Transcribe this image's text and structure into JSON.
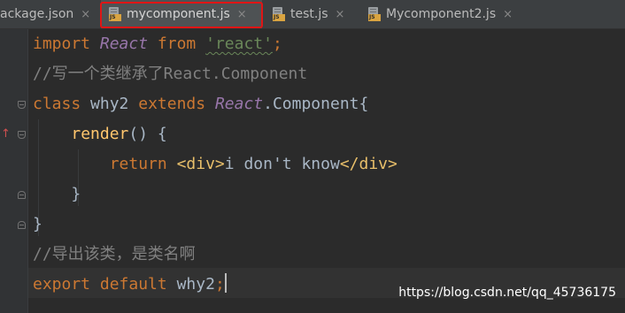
{
  "tabs": [
    {
      "label": "ackage.json",
      "icon": "json-file-icon",
      "active": false,
      "highlighted": false
    },
    {
      "label": "mycomponent.js",
      "icon": "js-file-icon",
      "active": true,
      "highlighted": true
    },
    {
      "label": "test.js",
      "icon": "js-file-icon",
      "active": false,
      "highlighted": false
    },
    {
      "label": "Mycomponent2.js",
      "icon": "js-file-icon",
      "active": false,
      "highlighted": false
    }
  ],
  "icons": {
    "close": "×",
    "file_badge": "JS",
    "override_marker": "↑"
  },
  "code_lines": [
    {
      "t1": "import",
      "t2": "React",
      "t3": "from",
      "t4": "'react'",
      "t5": ";"
    },
    {
      "text": "//写一个类继承了React.Component"
    },
    {
      "t1": "class",
      "t2": "why2",
      "t3": "extends",
      "t4": "React",
      "t5": ".Component{"
    },
    {
      "t1": "render",
      "t2": "() {"
    },
    {
      "t1": "return",
      "t2": "<div>",
      "t3": "i don't know",
      "t4": "</div>"
    },
    {
      "text": "}"
    },
    {
      "text": "}"
    },
    {
      "text": "//导出该类，是类名啊"
    },
    {
      "t1": "export",
      "t2": "default",
      "t3": "why2",
      "t4": ";"
    }
  ],
  "watermark": "https://blog.csdn.net/qq_45736175",
  "colors": {
    "editor_background": "#2b2b2b",
    "keyword": "#cc7832",
    "class_reference": "#9876aa",
    "function": "#ffc66d",
    "string": "#6a8759",
    "comment": "#808080",
    "jsx_tag": "#e8bf6a",
    "highlight_box": "#e01515"
  }
}
